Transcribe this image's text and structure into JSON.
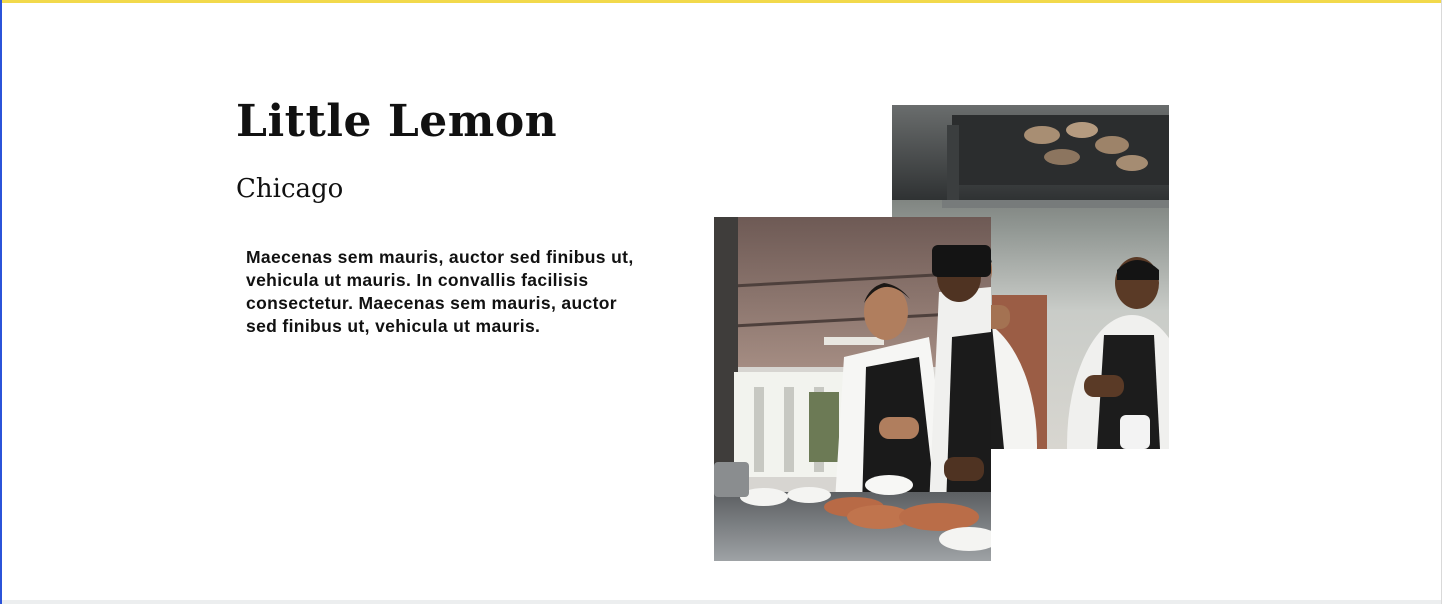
{
  "hero": {
    "title": "Little Lemon",
    "subtitle": "Chicago",
    "description": "Maecenas sem mauris, auctor sed finibus ut, vehicula ut mauris. In convallis facilisis consectetur. Maecenas sem mauris, auctor sed finibus ut, vehicula ut mauris."
  },
  "images": {
    "back_photo": "chefs-laughing-photo",
    "front_photo": "chefs-cooking-photo"
  },
  "colors": {
    "top_rule": "#f2d94b",
    "left_border": "#2b53d9",
    "text": "#111111",
    "background": "#ffffff"
  }
}
